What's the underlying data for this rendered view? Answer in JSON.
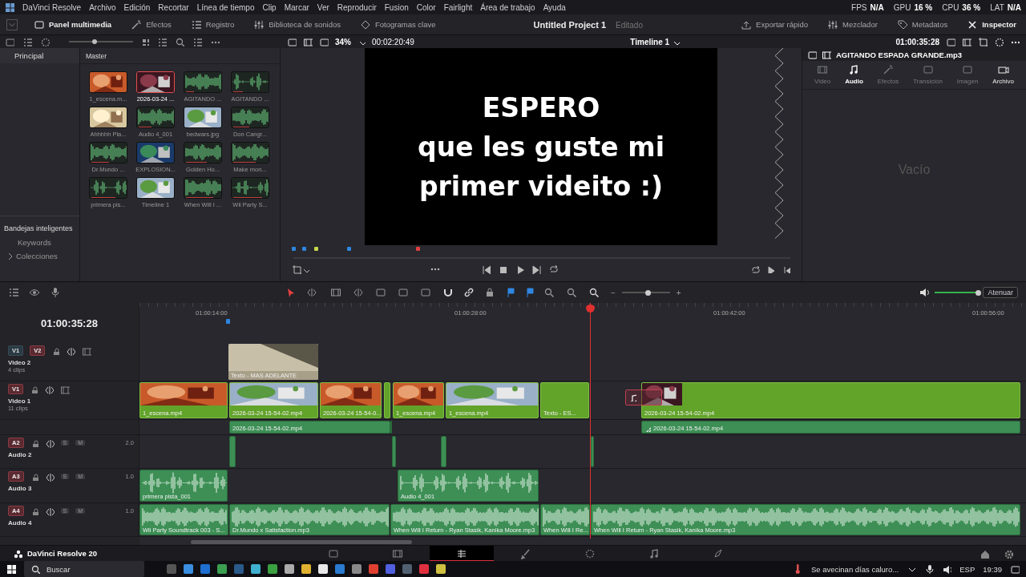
{
  "menu_bar": {
    "app_name": "DaVinci Resolve",
    "items": [
      "Archivo",
      "Edición",
      "Recortar",
      "Línea de tiempo",
      "Clip",
      "Marcar",
      "Ver",
      "Reproducir",
      "Fusion",
      "Color",
      "Fairlight",
      "Área de trabajo",
      "Ayuda"
    ],
    "stats": [
      {
        "label": "FPS",
        "value": "N/A"
      },
      {
        "label": "GPU",
        "value": "16 %"
      },
      {
        "label": "CPU",
        "value": "36 %"
      },
      {
        "label": "LAT",
        "value": "N/A"
      }
    ]
  },
  "toolbar": {
    "left": [
      {
        "label": "Panel multimedia",
        "selected": true
      },
      {
        "label": "Efectos",
        "selected": false
      },
      {
        "label": "Registro",
        "selected": false
      },
      {
        "label": "Biblioteca de sonidos",
        "selected": false
      },
      {
        "label": "Fotogramas clave",
        "selected": false
      }
    ],
    "project": "Untitled Project 1",
    "project_state": "Editado",
    "right": [
      {
        "label": "Exportar rápido",
        "selected": false
      },
      {
        "label": "Mezclador",
        "selected": false
      },
      {
        "label": "Metadatos",
        "selected": false
      },
      {
        "label": "Inspector",
        "selected": true
      }
    ]
  },
  "sidebar": {
    "items": [
      {
        "label": "Principal",
        "selected": true
      }
    ],
    "smart_bins_title": "Bandejas inteligentes",
    "smart_bins": [
      {
        "label": "Keywords",
        "expandable": false
      },
      {
        "label": "Colecciones",
        "expandable": true
      }
    ]
  },
  "media_pool": {
    "bin": "Master",
    "thumbnail_size": {
      "level": 0.4
    },
    "clips": [
      {
        "name": "1_escena.m...",
        "kind": "picture",
        "selected": false
      },
      {
        "name": "2026-03-24 ...",
        "kind": "picture",
        "selected": true
      },
      {
        "name": "AGITANDO ...",
        "kind": "audio",
        "selected": false
      },
      {
        "name": "AGITANDO ...",
        "kind": "audio",
        "selected": false
      },
      {
        "name": "Ahhhhh Pla...",
        "kind": "picture",
        "selected": false
      },
      {
        "name": "Audio 4_001",
        "kind": "audio",
        "selected": false
      },
      {
        "name": "bedwars.jpg",
        "kind": "picture",
        "selected": false
      },
      {
        "name": "Don Cangr...",
        "kind": "audio",
        "selected": false
      },
      {
        "name": "Dr.Mundo ...",
        "kind": "audio",
        "selected": false
      },
      {
        "name": "EXPLOSION...",
        "kind": "picture",
        "selected": false
      },
      {
        "name": "Golden Ho...",
        "kind": "audio",
        "selected": false
      },
      {
        "name": "Make mon...",
        "kind": "audio",
        "selected": false
      },
      {
        "name": "primera pis...",
        "kind": "audio",
        "selected": false
      },
      {
        "name": "Timeline 1",
        "kind": "picture",
        "selected": false
      },
      {
        "name": "When Will I ...",
        "kind": "audio",
        "selected": false
      },
      {
        "name": "Wii Party S...",
        "kind": "audio",
        "selected": false
      }
    ]
  },
  "viewer": {
    "zoom": "34%",
    "duration": "00:02:20:49",
    "timeline": "Timeline 1",
    "timecode": "01:00:35:28",
    "overlay_lines": [
      "ESPERO",
      "que les guste mi",
      "primer videito :)"
    ],
    "markers": [
      {
        "color": "#2f86e0"
      },
      {
        "color": "#2f86e0"
      },
      {
        "color": "#c8d84a"
      },
      {
        "color": "#2f86e0"
      },
      {
        "color": "#e04040"
      }
    ]
  },
  "inspector": {
    "title": "AGITANDO ESPADA GRANDE.mp3",
    "tabs": [
      {
        "label": "Video",
        "disabled": true,
        "selected": false
      },
      {
        "label": "Audio",
        "disabled": false,
        "selected": true
      },
      {
        "label": "Efectos",
        "disabled": true,
        "selected": false
      },
      {
        "label": "Transición",
        "disabled": true,
        "selected": false
      },
      {
        "label": "Imagen",
        "disabled": true,
        "selected": false
      },
      {
        "label": "Archivo",
        "disabled": false,
        "selected": false
      }
    ],
    "empty_text": "Vacío"
  },
  "timeline": {
    "timecode": "01:00:35:28",
    "ruler": [
      "01:00:14:00",
      "01:00:28:00",
      "01:00:42:00",
      "01:00:56:00"
    ],
    "zoom": {
      "level": 0.55,
      "out_label": "−",
      "in_label": "+"
    },
    "volume": {
      "level": 1
    },
    "dim_button": "Atenuar",
    "tracks": [
      {
        "kind": "video",
        "badges": [
          {
            "label": "V1",
            "selected": false
          },
          {
            "label": "V2",
            "selected": true
          }
        ],
        "name": "Video 2",
        "info": "4 clips",
        "clips": [
          {
            "kind": "title",
            "label": "Texto - MAS ADELANTE"
          }
        ]
      },
      {
        "kind": "video",
        "badges": [
          {
            "label": "V1",
            "selected": true
          }
        ],
        "name": "Video 1",
        "info": "11 clips",
        "clips": [
          {
            "kind": "video",
            "label": "1_escena.mp4"
          },
          {
            "kind": "video",
            "label": "2026-03-24 15-54-02.mp4"
          },
          {
            "kind": "video",
            "label": "2026-03-24 15-54-0..."
          },
          {
            "kind": "blank"
          },
          {
            "kind": "video",
            "label": "1_escena.mp4"
          },
          {
            "kind": "video",
            "label": "1_escena.mp4"
          },
          {
            "kind": "text",
            "label": "Texto - ES..."
          },
          {
            "kind": "video",
            "label": "2026-03-24 15-54-02.mp4"
          },
          {
            "kind": "ghost"
          }
        ]
      },
      {
        "kind": "strip",
        "clips": [
          {
            "kind": "audio",
            "label": "2026-03-24 15-54-02.mp4"
          },
          {
            "kind": "audio"
          },
          {
            "kind": "linked",
            "label": "2026-03-24 15-54-02.mp4"
          }
        ]
      },
      {
        "kind": "audio",
        "badges": [
          {
            "label": "A2",
            "selected": true
          }
        ],
        "name": "Audio 2",
        "level_text": "2.0",
        "solo_label": "S",
        "mute_label": "M",
        "clips": [
          {
            "kind": "audio"
          },
          {
            "kind": "audio"
          },
          {
            "kind": "audio"
          },
          {
            "kind": "audio"
          }
        ]
      },
      {
        "kind": "audio",
        "badges": [
          {
            "label": "A3",
            "selected": true
          }
        ],
        "name": "Audio 3",
        "level_text": "1.0",
        "solo_label": "S",
        "mute_label": "M",
        "clips": [
          {
            "kind": "audio",
            "label": "primera pista_001"
          },
          {
            "kind": "audio",
            "label": "Audio 4_001"
          }
        ]
      },
      {
        "kind": "audio",
        "badges": [
          {
            "label": "A4",
            "selected": true
          }
        ],
        "name": "Audio 4",
        "level_text": "1.0",
        "solo_label": "S",
        "mute_label": "M",
        "clips": [
          {
            "kind": "audio",
            "label": "Wii Party Soundtrack 003 - S..."
          },
          {
            "kind": "audio",
            "label": "Dr.Mundo x Satisfaction.mp3"
          },
          {
            "kind": "audio",
            "label": "When Will I Return - Ryan Stasik, Kanika Moore.mp3"
          },
          {
            "kind": "audio",
            "label": "When Will I Re..."
          },
          {
            "kind": "audio",
            "label": "When Will I Return - Ryan Stasik, Kanika Moore.mp3"
          }
        ]
      }
    ]
  },
  "page_bar": {
    "app_name": "DaVinci Resolve 20",
    "pages": [
      {
        "kind": "media",
        "selected": false
      },
      {
        "kind": "cut",
        "selected": false
      },
      {
        "kind": "edit",
        "selected": true
      },
      {
        "kind": "fusion",
        "selected": false
      },
      {
        "kind": "color",
        "selected": false
      },
      {
        "kind": "fairlight",
        "selected": false
      },
      {
        "kind": "deliver",
        "selected": false
      }
    ]
  },
  "taskbar": {
    "search": "Buscar",
    "weather": "Se avecinan días caluro...",
    "language": "ESP",
    "time": "19:39"
  }
}
